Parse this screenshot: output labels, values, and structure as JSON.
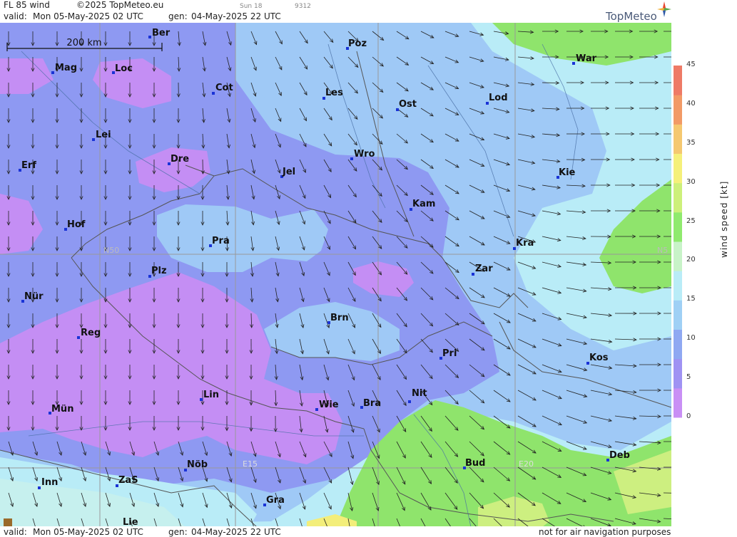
{
  "header": {
    "product": "FL 85 wind",
    "copyright": "©2025 TopMeteo.eu",
    "valid_label": "valid:",
    "valid_time": "Mon  05-May-2025  02 UTC",
    "gen_label": "gen:",
    "gen_time": "04-May-2025 22 UTC",
    "sun": "Sun 18",
    "code": "9312",
    "logo": "TopMeteo"
  },
  "footer": {
    "valid_label": "valid:",
    "valid_time": "Mon  05-May-2025  02 UTC",
    "gen_label": "gen:",
    "gen_time": "04-May-2025 22 UTC",
    "disclaimer": "not for air navigation purposes"
  },
  "map": {
    "scale_label": "200 km",
    "grid_labels": {
      "n50": "N50",
      "n50_right": "N5",
      "e15": "E15",
      "e20": "E20"
    },
    "cities": [
      {
        "name": "Ber"
      },
      {
        "name": "Poz"
      },
      {
        "name": "War"
      },
      {
        "name": "Mag"
      },
      {
        "name": "Loc"
      },
      {
        "name": "Cot"
      },
      {
        "name": "Les"
      },
      {
        "name": "Ost"
      },
      {
        "name": "Lod"
      },
      {
        "name": "Lei"
      },
      {
        "name": "Wro"
      },
      {
        "name": "Erf"
      },
      {
        "name": "Dre"
      },
      {
        "name": "Jel"
      },
      {
        "name": "Kie"
      },
      {
        "name": "Kam"
      },
      {
        "name": "Hof"
      },
      {
        "name": "Pra"
      },
      {
        "name": "Kra"
      },
      {
        "name": "Zar"
      },
      {
        "name": "Plz"
      },
      {
        "name": "Nür"
      },
      {
        "name": "Brn"
      },
      {
        "name": "Reg"
      },
      {
        "name": "Pri"
      },
      {
        "name": "Kos"
      },
      {
        "name": "Lin"
      },
      {
        "name": "Nit"
      },
      {
        "name": "Wie"
      },
      {
        "name": "Bra"
      },
      {
        "name": "Mün"
      },
      {
        "name": "Deb"
      },
      {
        "name": "Nöb"
      },
      {
        "name": "Bud"
      },
      {
        "name": "Inn"
      },
      {
        "name": "ZaS"
      },
      {
        "name": "Gra"
      },
      {
        "name": "Lie"
      }
    ]
  },
  "legend": {
    "unit": "wind speed [kt]",
    "range": [
      0,
      45
    ],
    "ticks": [
      "45",
      "40",
      "35",
      "30",
      "25",
      "20",
      "15",
      "10",
      "5",
      "0"
    ],
    "colors": [
      "#c98ff5",
      "#9f92f3",
      "#8fa8f2",
      "#9fd0f5",
      "#b9ecf7",
      "#c8f3c8",
      "#8fea6e",
      "#cdf07a",
      "#f5f07a",
      "#f5c870",
      "#f29a66",
      "#ee7a66"
    ]
  }
}
